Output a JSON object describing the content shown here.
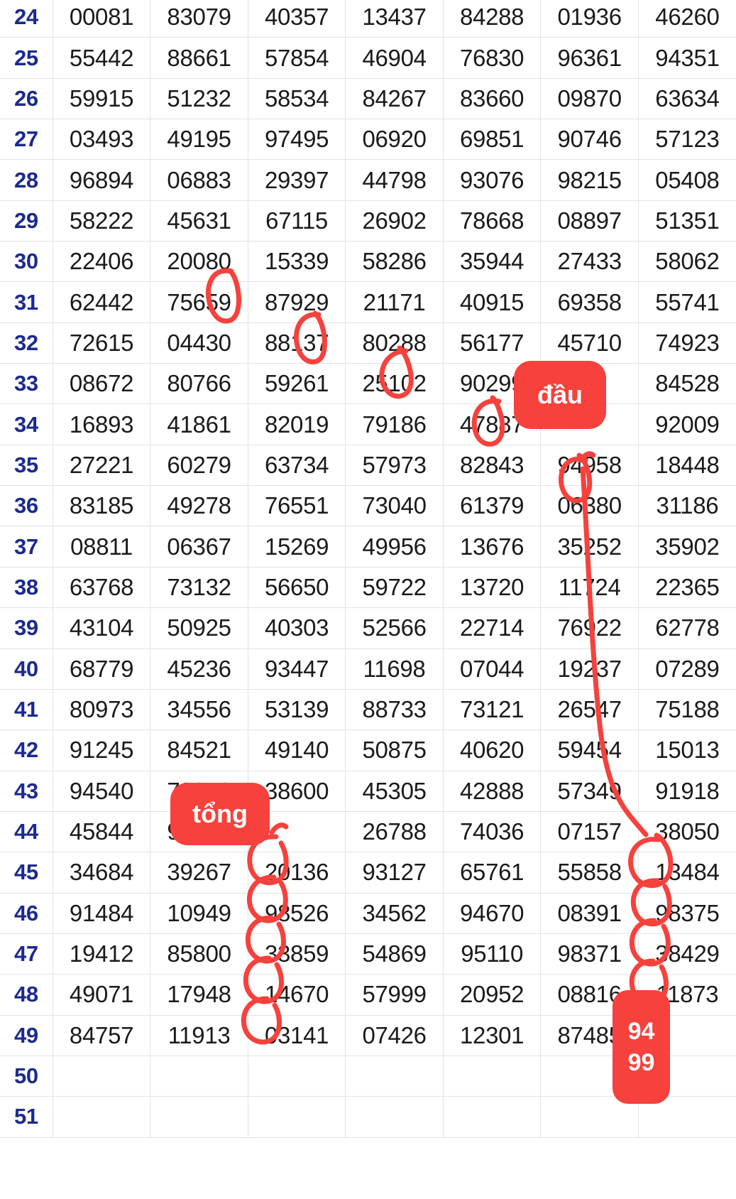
{
  "document": {
    "type": "spreadsheet-number-grid",
    "visible_row_range": "24-51",
    "column_count": 7,
    "row_index_color": "#1b2a8f",
    "cell_text_color": "#1a1a1a",
    "grid_line_color": "#e3e3e3",
    "background_color": "#ffffff",
    "annotation_color": "#f6413c"
  },
  "rows": [
    {
      "index": "24",
      "cells": [
        "00081",
        "83079",
        "40357",
        "13437",
        "84288",
        "01936",
        "46260"
      ]
    },
    {
      "index": "25",
      "cells": [
        "55442",
        "88661",
        "57854",
        "46904",
        "76830",
        "96361",
        "94351"
      ]
    },
    {
      "index": "26",
      "cells": [
        "59915",
        "51232",
        "58534",
        "84267",
        "83660",
        "09870",
        "63634"
      ]
    },
    {
      "index": "27",
      "cells": [
        "03493",
        "49195",
        "97495",
        "06920",
        "69851",
        "90746",
        "57123"
      ]
    },
    {
      "index": "28",
      "cells": [
        "96894",
        "06883",
        "29397",
        "44798",
        "93076",
        "98215",
        "05408"
      ]
    },
    {
      "index": "29",
      "cells": [
        "58222",
        "45631",
        "67115",
        "26902",
        "78668",
        "08897",
        "51351"
      ]
    },
    {
      "index": "30",
      "cells": [
        "22406",
        "20080",
        "15339",
        "58286",
        "35944",
        "27433",
        "58062"
      ]
    },
    {
      "index": "31",
      "cells": [
        "62442",
        "75659",
        "87929",
        "21171",
        "40915",
        "69358",
        "55741"
      ]
    },
    {
      "index": "32",
      "cells": [
        "72615",
        "04430",
        "88137",
        "80288",
        "56177",
        "45710",
        "74923"
      ]
    },
    {
      "index": "33",
      "cells": [
        "08672",
        "80766",
        "59261",
        "25102",
        "90299",
        "",
        "84528"
      ]
    },
    {
      "index": "34",
      "cells": [
        "16893",
        "41861",
        "82019",
        "79186",
        "47887",
        "",
        "92009"
      ]
    },
    {
      "index": "35",
      "cells": [
        "27221",
        "60279",
        "63734",
        "57973",
        "82843",
        "94958",
        "18448"
      ]
    },
    {
      "index": "36",
      "cells": [
        "83185",
        "49278",
        "76551",
        "73040",
        "61379",
        "06380",
        "31186"
      ]
    },
    {
      "index": "37",
      "cells": [
        "08811",
        "06367",
        "15269",
        "49956",
        "13676",
        "35252",
        "35902"
      ]
    },
    {
      "index": "38",
      "cells": [
        "63768",
        "73132",
        "56650",
        "59722",
        "13720",
        "11724",
        "22365"
      ]
    },
    {
      "index": "39",
      "cells": [
        "43104",
        "50925",
        "40303",
        "52566",
        "22714",
        "76922",
        "62778"
      ]
    },
    {
      "index": "40",
      "cells": [
        "68779",
        "45236",
        "93447",
        "11698",
        "07044",
        "19237",
        "07289"
      ]
    },
    {
      "index": "41",
      "cells": [
        "80973",
        "34556",
        "53139",
        "88733",
        "73121",
        "26547",
        "75188"
      ]
    },
    {
      "index": "42",
      "cells": [
        "91245",
        "84521",
        "49140",
        "50875",
        "40620",
        "59454",
        "15013"
      ]
    },
    {
      "index": "43",
      "cells": [
        "94540",
        "79276",
        "38600",
        "45305",
        "42888",
        "57349",
        "91918"
      ]
    },
    {
      "index": "44",
      "cells": [
        "45844",
        "91380",
        "",
        "26788",
        "74036",
        "07157",
        "38050"
      ]
    },
    {
      "index": "45",
      "cells": [
        "34684",
        "39267",
        "20136",
        "93127",
        "65761",
        "55858",
        "13484"
      ]
    },
    {
      "index": "46",
      "cells": [
        "91484",
        "10949",
        "98526",
        "34562",
        "94670",
        "08391",
        "98375"
      ]
    },
    {
      "index": "47",
      "cells": [
        "19412",
        "85800",
        "33859",
        "54869",
        "95110",
        "98371",
        "38429"
      ]
    },
    {
      "index": "48",
      "cells": [
        "49071",
        "17948",
        "14670",
        "57999",
        "20952",
        "08816",
        "11873"
      ]
    },
    {
      "index": "49",
      "cells": [
        "84757",
        "11913",
        "03141",
        "07426",
        "12301",
        "87485",
        ""
      ]
    },
    {
      "index": "50",
      "cells": [
        "",
        "",
        "",
        "",
        "",
        "",
        ""
      ]
    },
    {
      "index": "51",
      "cells": [
        "",
        "",
        "",
        "",
        "",
        "",
        ""
      ]
    }
  ],
  "annotations": {
    "badges": [
      {
        "id": "dau",
        "label": "đầu",
        "color": "#f6413c",
        "points_to": "94958"
      },
      {
        "id": "tong",
        "label": "tổng",
        "color": "#f6413c",
        "points_to": "20136"
      },
      {
        "id": "numbers",
        "line1": "94",
        "line2": "99",
        "color": "#f6413c",
        "points_to": "11873"
      }
    ],
    "circled_values": [
      "75659",
      "88137",
      "25102",
      "47887",
      "94958",
      "20136",
      "98526",
      "33859",
      "14670",
      "03141",
      "13484",
      "98375",
      "38429",
      "11873"
    ]
  }
}
